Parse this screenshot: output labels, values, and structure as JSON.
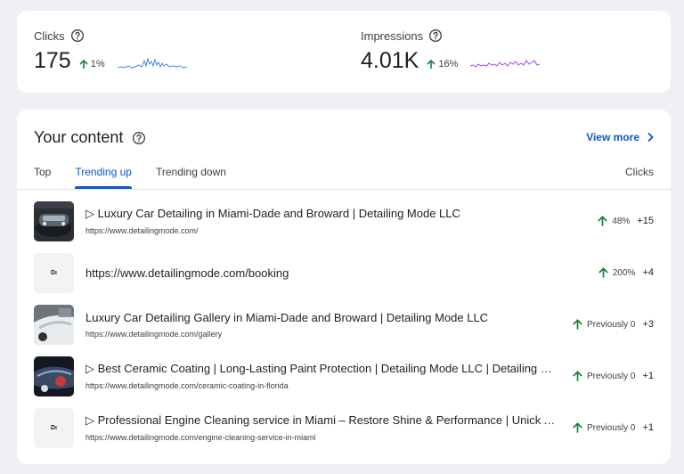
{
  "stats": {
    "clicks": {
      "label": "Clicks",
      "value": "175",
      "change": "1%"
    },
    "impressions": {
      "label": "Impressions",
      "value": "4.01K",
      "change": "16%"
    }
  },
  "content": {
    "title": "Your content",
    "view_more": "View more",
    "tabs": [
      {
        "label": "Top"
      },
      {
        "label": "Trending up"
      },
      {
        "label": "Trending down"
      }
    ],
    "active_tab": "Trending up",
    "column_header": "Clicks",
    "rows": [
      {
        "title": "▷ Luxury Car Detailing in Miami-Dade and Broward | Detailing Mode LLC",
        "url": "https://www.detailingmode.com/",
        "change": "48%",
        "delta": "+15",
        "thumb": "car-photo-thumbnail"
      },
      {
        "title": "https://www.detailingmode.com/booking",
        "url": "",
        "change": "200%",
        "delta": "+4",
        "thumb": "logo-thumbnail",
        "logo_text": "Dı"
      },
      {
        "title": "Luxury Car Detailing Gallery in Miami-Dade and Broward | Detailing Mode LLC",
        "url": "https://www.detailingmode.com/gallery",
        "change": "Previously 0",
        "delta": "+3",
        "thumb": "car-photo-thumbnail"
      },
      {
        "title": "▷ Best Ceramic Coating | Long-Lasting Paint Protection | Detailing Mode LLC | Detailing Mode LLC",
        "url": "https://www.detailingmode.com/ceramic-coating-in-florida",
        "change": "Previously 0",
        "delta": "+1",
        "thumb": "car-photo-thumbnail"
      },
      {
        "title": "▷ Professional Engine Cleaning service in Miami – Restore Shine & Performance | Unick Auto Detailing",
        "url": "https://www.detailingmode.com/engine-cleaning-service-in-miami",
        "change": "Previously 0",
        "delta": "+1",
        "thumb": "logo-thumbnail",
        "logo_text": "Dı"
      }
    ]
  },
  "colors": {
    "accent_blue": "#0b57d0",
    "clicks_line": "#4285f4",
    "impressions_line": "#a142f4",
    "trend_green": "#188038",
    "background": "#eef0f4"
  }
}
